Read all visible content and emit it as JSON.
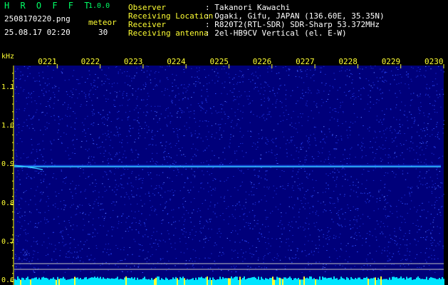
{
  "header": {
    "app_title": "H R O F F T",
    "app_version": "1.0.0",
    "file_name": "2508170220.png",
    "mode_label": "meteor",
    "datetime": "25.08.17 02:20",
    "count": "30",
    "info": [
      {
        "label": "Observer",
        "value": ": Takanori Kawachi"
      },
      {
        "label": "Receiving Location",
        "value": ": Ogaki, Gifu, JAPAN (136.60E, 35.35N)"
      },
      {
        "label": "Receiver",
        "value": ": R820T2(RTL-SDR) SDR-Sharp 53.372MHz"
      },
      {
        "label": "Receiving antenna",
        "value": ": 2el-HB9CV Vertical (el. E-W)"
      }
    ]
  },
  "colors": {
    "background": "#000000",
    "plot_background": "#00007a",
    "label_yellow": "#ffff33",
    "title_green": "#00ff66",
    "signal_line": "#33ccff",
    "noise_bar": "#00e5ff"
  },
  "chart_data": {
    "type": "heatmap",
    "y_unit_label": "kHz",
    "y_ticks": [
      "1.1",
      "1.0",
      "0.9",
      "0.8",
      "0.7",
      "0.6"
    ],
    "y_values": [
      1.1,
      1.0,
      0.9,
      0.8,
      0.7,
      0.6
    ],
    "ylim": [
      0.59,
      1.16
    ],
    "x_ticks": [
      "0221",
      "0222",
      "0223",
      "0224",
      "0225",
      "0226",
      "0227",
      "0228",
      "0229",
      "0230"
    ],
    "xlim": [
      220,
      230
    ],
    "carrier_frequency_khz": 0.897,
    "grid": false
  }
}
